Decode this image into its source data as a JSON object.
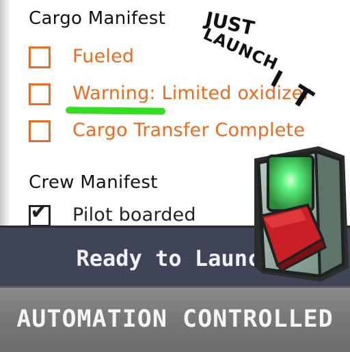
{
  "cargo": {
    "heading": "Cargo Manifest",
    "items": [
      {
        "label": "Fueled",
        "checked": false
      },
      {
        "label": "Warning: Limited oxidizer",
        "checked": false
      },
      {
        "label": "Cargo Transfer Complete",
        "checked": false
      }
    ]
  },
  "crew": {
    "heading": "Crew Manifest",
    "items": [
      {
        "label": "Pilot boarded",
        "checked": true
      }
    ]
  },
  "scrawl": {
    "word1": "JUST",
    "word2": "LAUNCH",
    "word3": "I",
    "word4": "T"
  },
  "status": {
    "ready_label": "Ready to Launch",
    "automation_label": "AUTOMATION CONTROLLED"
  },
  "launch_switch": {
    "light_color": "#3ef06a",
    "cover_color": "#c81e24",
    "state": "armed"
  },
  "colors": {
    "accent_orange": "#ef6a1c",
    "highlight_green": "#33dd22",
    "bar_dark": "#3f4458",
    "bar_gray": "#7a7a7a"
  }
}
